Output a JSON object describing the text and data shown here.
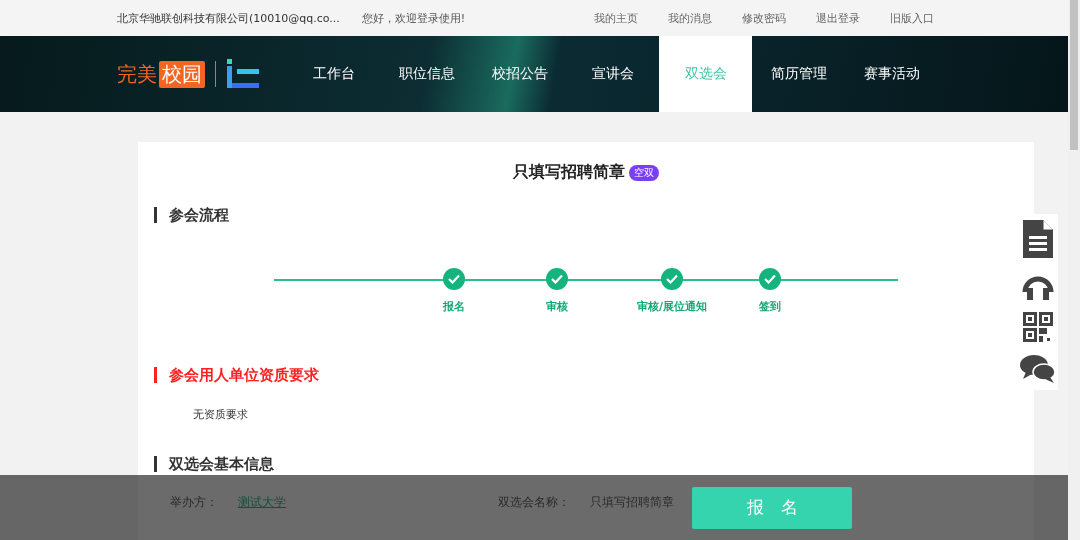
{
  "top_bar": {
    "account": "北京华驰联创科技有限公司(10010@qq.co...",
    "greeting": "您好，欢迎登录使用!",
    "links": [
      "我的主页",
      "我的消息",
      "修改密码",
      "退出登录",
      "旧版入口"
    ]
  },
  "nav": {
    "logo": {
      "word": "完美",
      "boxed": "校园"
    },
    "items": [
      {
        "label": "工作台",
        "selected": false
      },
      {
        "label": "职位信息",
        "selected": false
      },
      {
        "label": "校招公告",
        "selected": false
      },
      {
        "label": "宣讲会",
        "selected": false
      },
      {
        "label": "双选会",
        "selected": true
      },
      {
        "label": "简历管理",
        "selected": false
      },
      {
        "label": "赛事活动",
        "selected": false
      }
    ]
  },
  "page": {
    "title": "只填写招聘简章",
    "badge": "空双"
  },
  "flow": {
    "heading": "参会流程",
    "steps": [
      {
        "label": "报名",
        "done": true
      },
      {
        "label": "审核",
        "done": true
      },
      {
        "label": "审核/展位通知",
        "done": true
      },
      {
        "label": "签到",
        "done": true
      }
    ]
  },
  "requirements": {
    "heading": "参会用人单位资质要求",
    "highlight": true,
    "text": "无资质要求"
  },
  "basic_info": {
    "heading": "双选会基本信息",
    "fields": [
      {
        "label": "举办方：",
        "value": "测试大学",
        "kind": "link"
      },
      {
        "label": "双选会名称：",
        "value": "只填写招聘简章",
        "kind": "text"
      }
    ]
  },
  "signup_button": "报　名"
}
